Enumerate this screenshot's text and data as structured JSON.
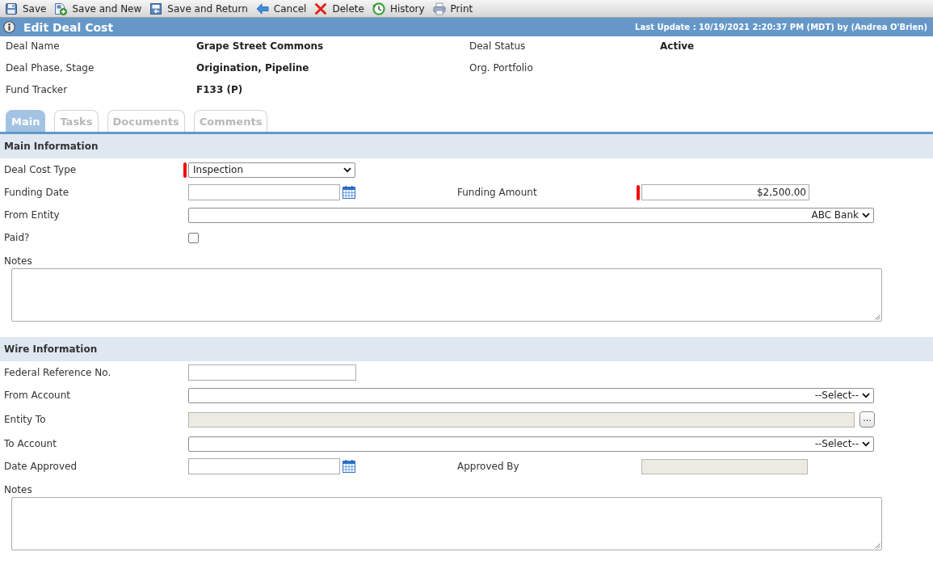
{
  "toolbar": [
    {
      "kind": "save",
      "label": "Save"
    },
    {
      "kind": "save_new",
      "label": "Save and New"
    },
    {
      "kind": "save_return",
      "label": "Save and Return"
    },
    {
      "kind": "cancel",
      "label": "Cancel"
    },
    {
      "kind": "delete",
      "label": "Delete"
    },
    {
      "kind": "history",
      "label": "History"
    },
    {
      "kind": "print",
      "label": "Print"
    }
  ],
  "header": {
    "title": "Edit Deal Cost",
    "last_update": "Last Update : 10/19/2021 2:20:37 PM (MDT) by (Andrea O'Brien)"
  },
  "summary": [
    {
      "label": "Deal Name",
      "value": "Grape Street Commons"
    },
    {
      "label": "Deal Status",
      "value": "Active"
    },
    {
      "label": "Deal Phase, Stage",
      "value": "Origination, Pipeline"
    },
    {
      "label": "Org. Portfolio"
    },
    {
      "label": "Fund Tracker",
      "value": "F133 (P)"
    }
  ],
  "tabs": [
    {
      "label": "Main",
      "selected": true
    },
    {
      "label": "Tasks",
      "selected": false
    },
    {
      "label": "Documents",
      "selected": false
    },
    {
      "label": "Comments",
      "selected": false
    }
  ],
  "sections": [
    {
      "title": "Main Information",
      "rows": [
        {
          "fields": [
            {
              "label": "Deal Cost Type",
              "kind": "select",
              "value": "Inspection",
              "required": true
            }
          ]
        },
        {
          "fields": [
            {
              "label": "Funding Date",
              "kind": "date",
              "required": false
            },
            {
              "label": "Funding Amount",
              "kind": "amount",
              "value": "$2,500.00",
              "required": true
            }
          ]
        },
        {
          "fields": [
            {
              "label": "From Entity",
              "kind": "select_wide",
              "value": "ABC Bank",
              "required": false
            }
          ]
        },
        {
          "fields": [
            {
              "label": "Paid?",
              "kind": "checkbox",
              "checked": false,
              "required": false
            }
          ]
        },
        {
          "fields": [
            {
              "label": "Notes",
              "kind": "textarea",
              "required": false
            }
          ]
        }
      ]
    },
    {
      "title": "Wire Information",
      "rows": [
        {
          "fields": [
            {
              "label": "Federal Reference No.",
              "kind": "text",
              "required": false
            }
          ]
        },
        {
          "fields": [
            {
              "label": "From Account",
              "kind": "select_wide",
              "value": "--Select--",
              "required": false
            }
          ]
        },
        {
          "fields": [
            {
              "label": "Entity To",
              "kind": "lookup",
              "button": "...",
              "required": false
            }
          ]
        },
        {
          "fields": [
            {
              "label": "To Account",
              "kind": "select_wide",
              "value": "--Select--",
              "required": false
            }
          ]
        },
        {
          "fields": [
            {
              "label": "Date Approved",
              "kind": "date",
              "required": false
            },
            {
              "label": "Approved By",
              "kind": "readonly",
              "required": false
            }
          ]
        },
        {
          "fields": [
            {
              "label": "Notes",
              "kind": "textarea",
              "required": false
            }
          ]
        }
      ]
    }
  ]
}
